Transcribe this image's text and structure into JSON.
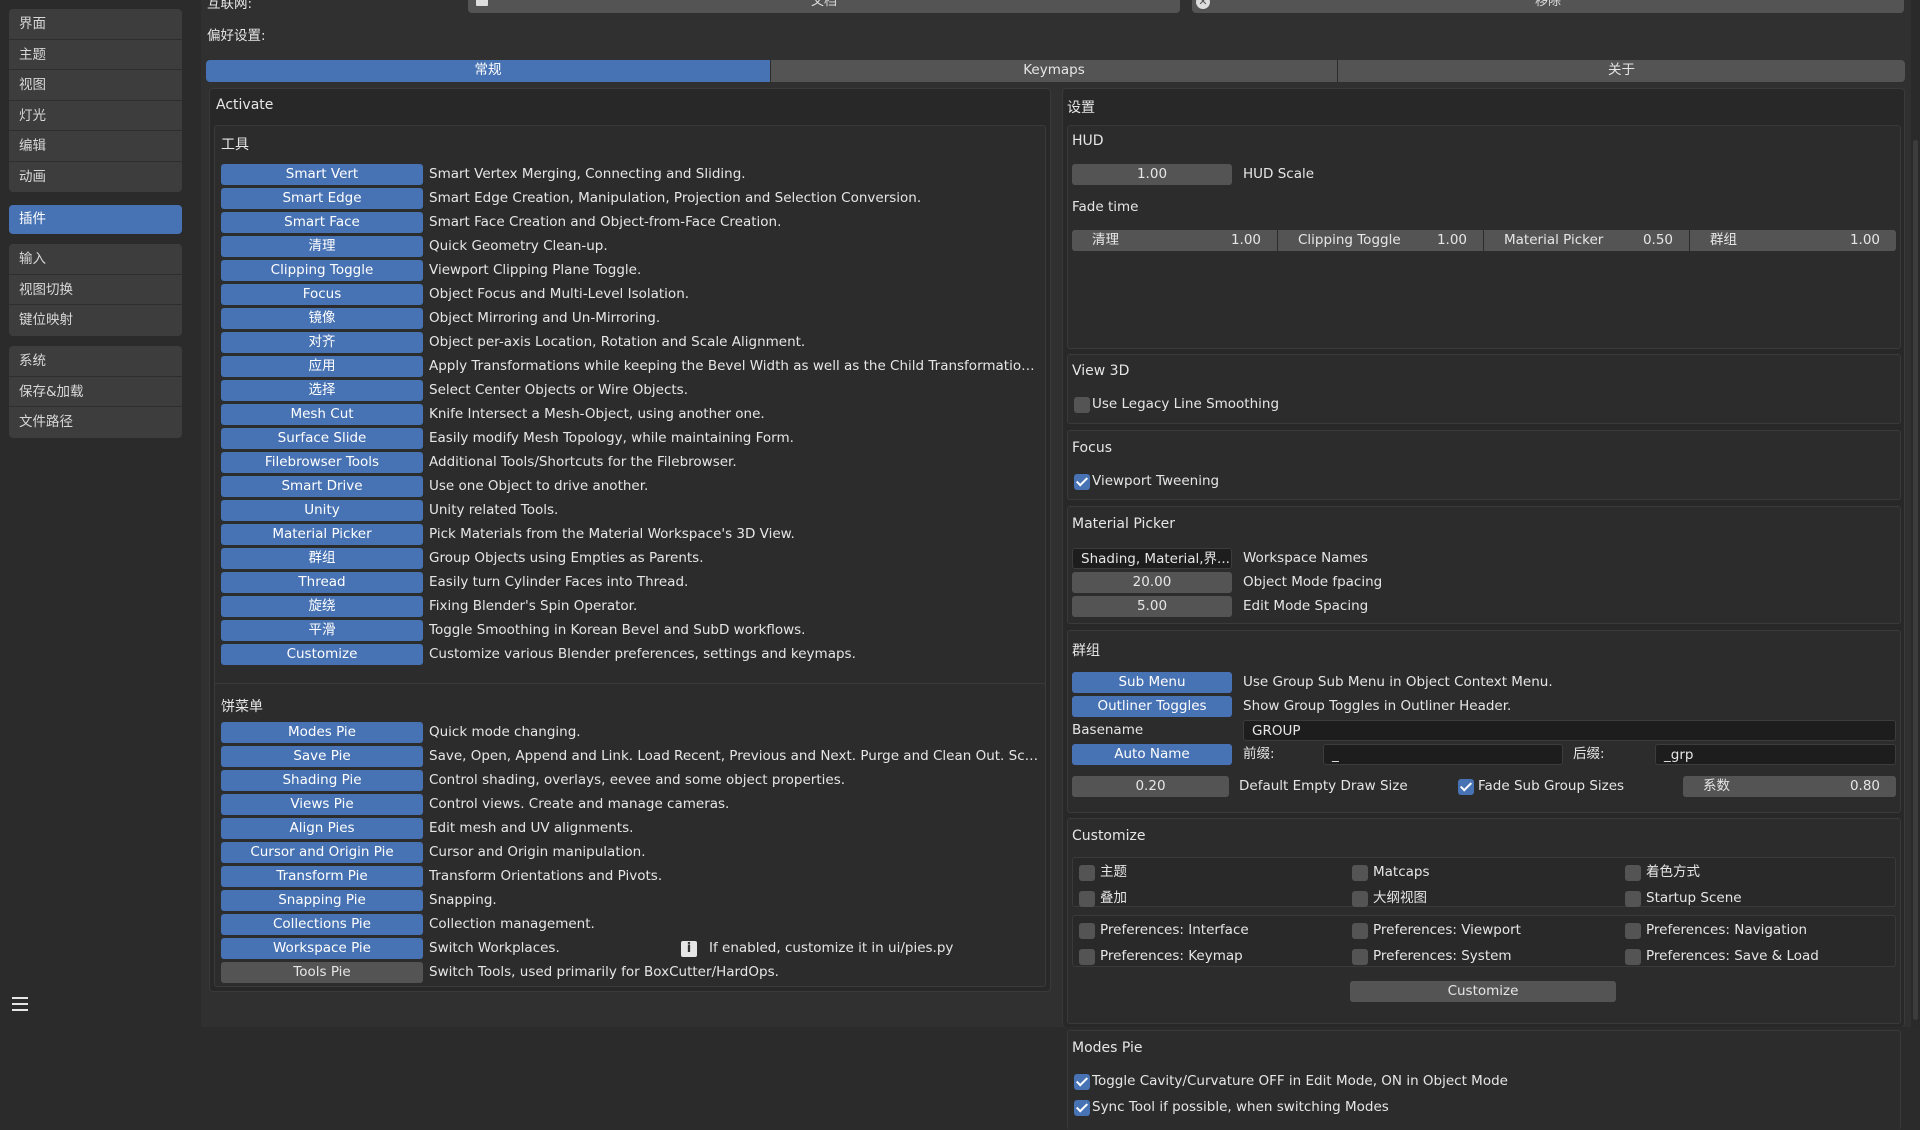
{
  "sidebar": {
    "group1": [
      "界面",
      "主题",
      "视图",
      "灯光",
      "编辑",
      "动画"
    ],
    "active": "插件",
    "group2": [
      "输入",
      "视图切换",
      "键位映射"
    ],
    "group3": [
      "系统",
      "保存&加载",
      "文件路径"
    ]
  },
  "top": {
    "internet_label": "互联网:",
    "docs_label": "文档",
    "remove_label": "移除"
  },
  "prefs_label": "偏好设置:",
  "tabs": [
    "常规",
    "Keymaps",
    "关于"
  ],
  "activate": {
    "title": "Activate",
    "tools_title": "工具",
    "tools": [
      {
        "label": "Smart Vert",
        "desc": "Smart Vertex Merging, Connecting and Sliding.",
        "on": true
      },
      {
        "label": "Smart Edge",
        "desc": "Smart Edge Creation, Manipulation, Projection and Selection Conversion.",
        "on": true
      },
      {
        "label": "Smart Face",
        "desc": "Smart Face Creation and Object-from-Face Creation.",
        "on": true
      },
      {
        "label": "清理",
        "desc": "Quick Geometry Clean-up.",
        "on": true
      },
      {
        "label": "Clipping Toggle",
        "desc": "Viewport Clipping Plane Toggle.",
        "on": true
      },
      {
        "label": "Focus",
        "desc": "Object Focus and Multi-Level Isolation.",
        "on": true
      },
      {
        "label": "镜像",
        "desc": "Object Mirroring and Un-Mirroring.",
        "on": true
      },
      {
        "label": "对齐",
        "desc": "Object per-axis Location, Rotation and Scale Alignment.",
        "on": true
      },
      {
        "label": "应用",
        "desc": "Apply Transformations while keeping the Bevel Width as well as the Child Transformations unch...",
        "on": true
      },
      {
        "label": "选择",
        "desc": "Select Center Objects or Wire Objects.",
        "on": true
      },
      {
        "label": "Mesh Cut",
        "desc": "Knife Intersect a Mesh-Object, using another one.",
        "on": true
      },
      {
        "label": "Surface Slide",
        "desc": "Easily modify Mesh Topology, while maintaining Form.",
        "on": true
      },
      {
        "label": "Filebrowser Tools",
        "desc": "Additional Tools/Shortcuts for the Filebrowser.",
        "on": true
      },
      {
        "label": "Smart Drive",
        "desc": "Use one Object to drive another.",
        "on": true
      },
      {
        "label": "Unity",
        "desc": "Unity related Tools.",
        "on": true
      },
      {
        "label": "Material Picker",
        "desc": "Pick Materials from the Material Workspace's 3D View.",
        "on": true
      },
      {
        "label": "群组",
        "desc": "Group Objects using Empties as Parents.",
        "on": true
      },
      {
        "label": "Thread",
        "desc": "Easily turn Cylinder Faces into Thread.",
        "on": true
      },
      {
        "label": "旋绕",
        "desc": "Fixing Blender's Spin Operator.",
        "on": true
      },
      {
        "label": "平滑",
        "desc": "Toggle Smoothing in Korean Bevel and SubD workflows.",
        "on": true
      },
      {
        "label": "Customize",
        "desc": "Customize various Blender preferences, settings and keymaps.",
        "on": true
      }
    ],
    "pies_title": "饼菜单",
    "pies": [
      {
        "label": "Modes Pie",
        "desc": "Quick mode changing.",
        "on": true
      },
      {
        "label": "Save Pie",
        "desc": "Save, Open, Append and Link. Load Recent, Previous and Next. Purge and Clean Out. ScreenC...",
        "on": true
      },
      {
        "label": "Shading Pie",
        "desc": "Control shading, overlays, eevee and some object properties.",
        "on": true
      },
      {
        "label": "Views Pie",
        "desc": "Control views. Create and manage cameras.",
        "on": true
      },
      {
        "label": "Align Pies",
        "desc": "Edit mesh and UV alignments.",
        "on": true
      },
      {
        "label": "Cursor and Origin Pie",
        "desc": "Cursor and Origin manipulation.",
        "on": true
      },
      {
        "label": "Transform Pie",
        "desc": "Transform Orientations and Pivots.",
        "on": true
      },
      {
        "label": "Snapping Pie",
        "desc": "Snapping.",
        "on": true
      },
      {
        "label": "Collections Pie",
        "desc": "Collection management.",
        "on": true
      },
      {
        "label": "Workspace Pie",
        "desc": "Switch Workplaces.",
        "on": true
      },
      {
        "label": "Tools Pie",
        "desc": "Switch Tools, used primarily for BoxCutter/HardOps.",
        "on": false
      }
    ],
    "workspace_note": "If enabled, customize it in ui/pies.py",
    "info_icon_glyph": "i"
  },
  "settings": {
    "title": "设置",
    "hud": {
      "title": "HUD",
      "scale_value": "1.00",
      "scale_label": "HUD Scale",
      "fade_title": "Fade time",
      "fade": [
        {
          "name": "清理",
          "value": "1.00"
        },
        {
          "name": "Clipping Toggle",
          "value": "1.00"
        },
        {
          "name": "Material Picker",
          "value": "0.50"
        },
        {
          "name": "群组",
          "value": "1.00"
        }
      ]
    },
    "view3d": {
      "title": "View 3D",
      "legacy_label": "Use Legacy Line Smoothing",
      "legacy_checked": false
    },
    "focus": {
      "title": "Focus",
      "tween_label": "Viewport Tweening",
      "tween_checked": true
    },
    "material_picker": {
      "title": "Material Picker",
      "workspace_value": "Shading, Material,界...",
      "workspace_label": "Workspace Names",
      "obj_value": "20.00",
      "obj_label": "Object Mode fpacing",
      "edit_value": "5.00",
      "edit_label": "Edit Mode Spacing"
    },
    "group": {
      "title": "群组",
      "submenu_btn": "Sub Menu",
      "submenu_desc": "Use Group Sub Menu in Object Context Menu.",
      "outliner_btn": "Outliner Toggles",
      "outliner_desc": "Show Group Toggles in Outliner Header.",
      "basename_label": "Basename",
      "basename_value": "GROUP",
      "autoname_btn": "Auto Name",
      "prefix_label": "前缀:",
      "prefix_value": "_",
      "suffix_label": "后缀:",
      "suffix_value": "_grp",
      "draw_size_value": "0.20",
      "draw_size_label": "Default Empty Draw Size",
      "fade_sub_label": "Fade Sub Group Sizes",
      "fade_sub_checked": true,
      "factor_name": "系数",
      "factor_value": "0.80"
    },
    "customize": {
      "title": "Customize",
      "row1": [
        {
          "label": "主题",
          "checked": false
        },
        {
          "label": "Matcaps",
          "checked": false
        },
        {
          "label": "着色方式",
          "checked": false
        }
      ],
      "row2": [
        {
          "label": "叠加",
          "checked": false
        },
        {
          "label": "大纲视图",
          "checked": false
        },
        {
          "label": "Startup Scene",
          "checked": false
        }
      ],
      "row3": [
        {
          "label": "Preferences: Interface",
          "checked": false
        },
        {
          "label": "Preferences: Viewport",
          "checked": false
        },
        {
          "label": "Preferences: Navigation",
          "checked": false
        }
      ],
      "row4": [
        {
          "label": "Preferences: Keymap",
          "checked": false
        },
        {
          "label": "Preferences: System",
          "checked": false
        },
        {
          "label": "Preferences: Save & Load",
          "checked": false
        }
      ],
      "button": "Customize"
    },
    "modes_pie": {
      "title": "Modes Pie",
      "opt1": "Toggle Cavity/Curvature OFF in Edit Mode, ON in Object Mode",
      "opt1_checked": true,
      "opt2": "Sync Tool if possible, when switching Modes",
      "opt2_checked": true
    }
  },
  "colors": {
    "accent": "#4772b3",
    "button": "#545454",
    "panel": "#282828",
    "bg": "#303030"
  }
}
